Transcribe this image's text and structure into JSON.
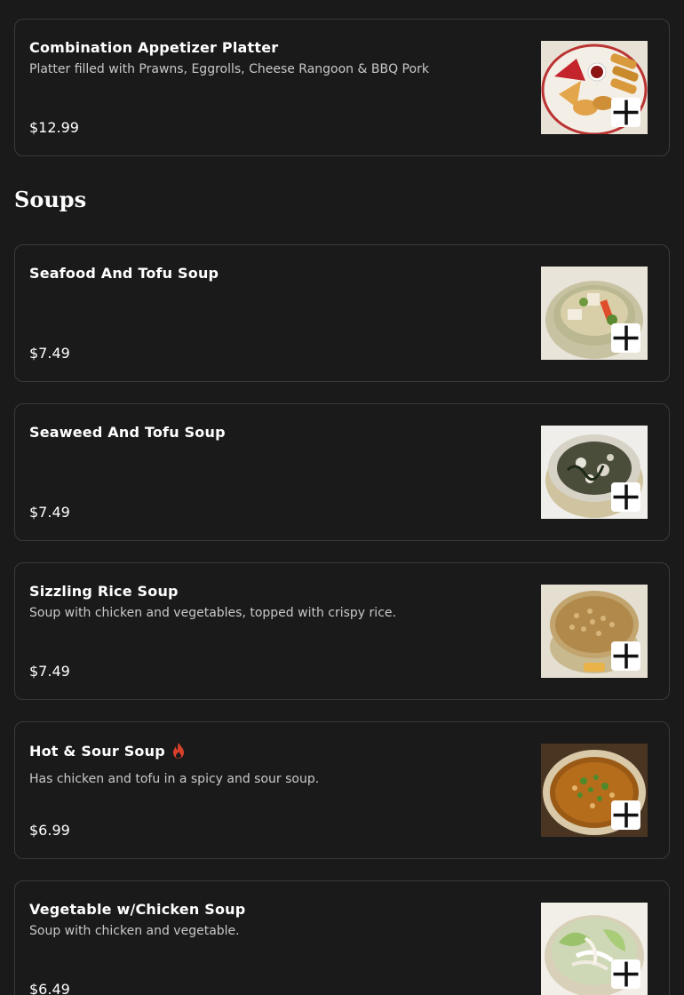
{
  "section": {
    "title": "Soups"
  },
  "items": [
    {
      "name": "Combination Appetizer Platter",
      "description": "Platter filled with Prawns, Eggrolls, Cheese Rangoon & BBQ Pork",
      "price": "$12.99",
      "image_icon": "platter-photo",
      "spicy": false
    },
    {
      "name": "Seafood And Tofu Soup",
      "description": "",
      "price": "$7.49",
      "image_icon": "soup-photo",
      "spicy": false
    },
    {
      "name": "Seaweed And Tofu Soup",
      "description": "",
      "price": "$7.49",
      "image_icon": "soup-photo",
      "spicy": false
    },
    {
      "name": "Sizzling Rice Soup",
      "description": "Soup with chicken and vegetables, topped with crispy rice.",
      "price": "$7.49",
      "image_icon": "soup-photo",
      "spicy": false
    },
    {
      "name": "Hot & Sour Soup",
      "description": "Has chicken and tofu in a spicy and sour soup.",
      "price": "$6.99",
      "image_icon": "soup-photo",
      "spicy": true
    },
    {
      "name": "Vegetable w/Chicken Soup",
      "description": "Soup with chicken and vegetable.",
      "price": "$6.49",
      "image_icon": "soup-photo",
      "spicy": false
    }
  ],
  "colors": {
    "background": "#1a1a1a",
    "card_border": "#3a3a3a",
    "spicy_icon": "#d9402b",
    "add_button": "#ffffff"
  }
}
